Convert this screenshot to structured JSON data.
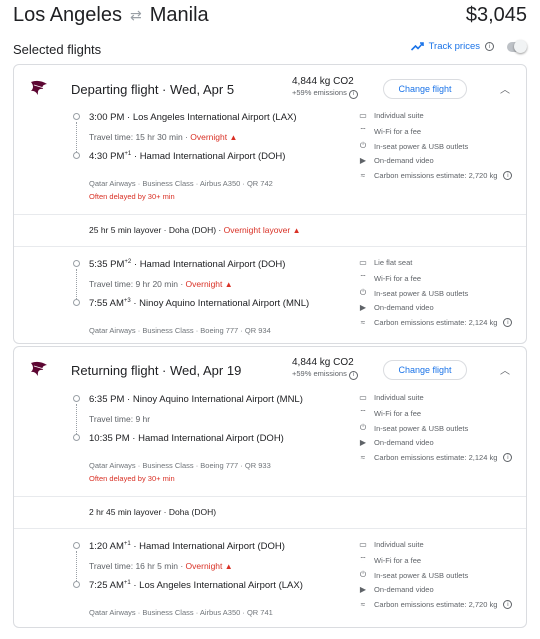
{
  "header": {
    "origin": "Los Angeles",
    "destination": "Manila",
    "swap_icon": "⇄",
    "price": "$3,045"
  },
  "selected": {
    "title": "Selected flights",
    "track_label": "Track prices"
  },
  "departing": {
    "title": "Departing flight · Wed, Apr 5",
    "co2": "4,844 kg CO2",
    "emissions": "+59% emissions",
    "change_label": "Change flight",
    "segments": [
      {
        "depart_time": "3:00 PM",
        "depart_sup": "",
        "depart_airport": "Los Angeles International Airport (LAX)",
        "travel_time": "Travel time: 15 hr 30 min",
        "overnight": "Overnight",
        "arrive_time": "4:30 PM",
        "arrive_sup": "+1",
        "arrive_airport": "Hamad International Airport (DOH)",
        "meta": "Qatar Airways · Business Class · Airbus A350 · QR 742",
        "delay": "Often delayed by 30+ min",
        "amenities": [
          "Individual suite",
          "Wi-Fi for a fee",
          "In-seat power & USB outlets",
          "On-demand video",
          "Carbon emissions estimate: 2,720 kg"
        ]
      },
      {
        "depart_time": "5:35 PM",
        "depart_sup": "+2",
        "depart_airport": "Hamad International Airport (DOH)",
        "travel_time": "Travel time: 9 hr 20 min",
        "overnight": "Overnight",
        "arrive_time": "7:55 AM",
        "arrive_sup": "+3",
        "arrive_airport": "Ninoy Aquino International Airport (MNL)",
        "meta": "Qatar Airways · Business Class · Boeing 777 · QR 934",
        "delay": "",
        "amenities": [
          "Lie flat seat",
          "Wi-Fi for a fee",
          "In-seat power & USB outlets",
          "On-demand video",
          "Carbon emissions estimate: 2,124 kg"
        ]
      }
    ],
    "layover": {
      "text": "25 hr 5 min layover · Doha (DOH) · ",
      "overnight": "Overnight layover"
    }
  },
  "returning": {
    "title": "Returning flight · Wed, Apr 19",
    "co2": "4,844 kg CO2",
    "emissions": "+59% emissions",
    "change_label": "Change flight",
    "segments": [
      {
        "depart_time": "6:35 PM",
        "depart_sup": "",
        "depart_airport": "Ninoy Aquino International Airport (MNL)",
        "travel_time": "Travel time: 9 hr",
        "overnight": "",
        "arrive_time": "10:35 PM",
        "arrive_sup": "",
        "arrive_airport": "Hamad International Airport (DOH)",
        "meta": "Qatar Airways · Business Class · Boeing 777 · QR 933",
        "delay": "Often delayed by 30+ min",
        "amenities": [
          "Individual suite",
          "Wi-Fi for a fee",
          "In-seat power & USB outlets",
          "On-demand video",
          "Carbon emissions estimate: 2,124 kg"
        ]
      },
      {
        "depart_time": "1:20 AM",
        "depart_sup": "+1",
        "depart_airport": "Hamad International Airport (DOH)",
        "travel_time": "Travel time: 16 hr 5 min",
        "overnight": "Overnight",
        "arrive_time": "7:25 AM",
        "arrive_sup": "+1",
        "arrive_airport": "Los Angeles International Airport (LAX)",
        "meta": "Qatar Airways · Business Class · Airbus A350 · QR 741",
        "delay": "",
        "amenities": [
          "Individual suite",
          "Wi-Fi for a fee",
          "In-seat power & USB outlets",
          "On-demand video",
          "Carbon emissions estimate: 2,720 kg"
        ]
      }
    ],
    "layover": {
      "text": "2 hr 45 min layover · Doha (DOH)",
      "overnight": ""
    }
  },
  "amenity_icons": [
    "seat-icon",
    "wifi-icon",
    "power-icon",
    "video-icon",
    "emissions-icon"
  ],
  "colors": {
    "accent": "#1a73e8",
    "warning": "#d93025",
    "airline": "#5c0632"
  }
}
